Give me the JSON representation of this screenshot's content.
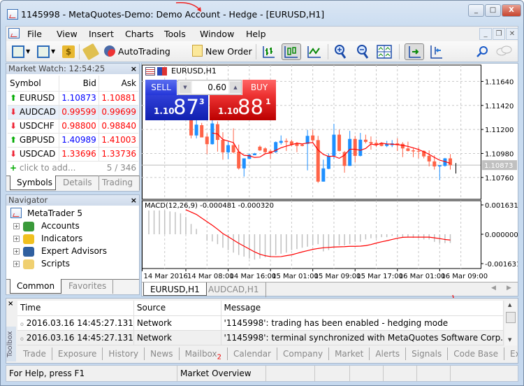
{
  "window": {
    "title": "1145998 - MetaQuotes-Demo: Demo Account - Hedge - [EURUSD,H1]",
    "minimize": "_",
    "maximize": "□",
    "close": "X"
  },
  "menu": [
    "File",
    "View",
    "Insert",
    "Charts",
    "Tools",
    "Window",
    "Help"
  ],
  "toolbar": {
    "autotrading": "AutoTrading",
    "new_order": "New Order",
    "icons": [
      "new-chart-icon",
      "profiles-icon",
      "market-watch-icon",
      "metaeditor-icon",
      "autotrading-icon",
      "new-order-icon",
      "bar-chart-icon",
      "candlestick-icon",
      "line-chart-icon",
      "zoom-in-icon",
      "zoom-out-icon",
      "tile-windows-icon",
      "autoscroll-icon",
      "chart-shift-icon",
      "search-icon",
      "chat-icon"
    ]
  },
  "market_watch": {
    "title": "Market Watch: 12:54:25",
    "columns": [
      "Symbol",
      "Bid",
      "Ask"
    ],
    "rows": [
      {
        "symbol": "EURUSD",
        "dir": "up",
        "bid": "1.10873",
        "ask": "1.10881",
        "bid_color": "blue"
      },
      {
        "symbol": "AUDCAD",
        "dir": "down",
        "bid": "0.99599",
        "ask": "0.99699",
        "bid_color": "red"
      },
      {
        "symbol": "USDCHF",
        "dir": "down",
        "bid": "0.98800",
        "ask": "0.98840",
        "bid_color": "red"
      },
      {
        "symbol": "GBPUSD",
        "dir": "up",
        "bid": "1.40989",
        "ask": "1.41003",
        "bid_color": "blue"
      },
      {
        "symbol": "USDCAD",
        "dir": "down",
        "bid": "1.33696",
        "ask": "1.33736",
        "bid_color": "red"
      }
    ],
    "add": "click to add...",
    "count": "5 / 346",
    "tabs": [
      "Symbols",
      "Details",
      "Trading"
    ]
  },
  "navigator": {
    "title": "Navigator",
    "root": "MetaTrader 5",
    "items": [
      "Accounts",
      "Indicators",
      "Expert Advisors",
      "Scripts"
    ],
    "tabs": [
      "Common",
      "Favorites"
    ]
  },
  "chart": {
    "symbol": "EURUSD,H1",
    "sell": "SELL",
    "buy": "BUY",
    "volume": "0.60",
    "sell_price": {
      "prefix": "1.10",
      "big": "87",
      "sup": "3"
    },
    "buy_price": {
      "prefix": "1.10",
      "big": "88",
      "sup": "1"
    },
    "price_ticks": [
      "1.11640",
      "1.11420",
      "1.11200",
      "1.10980",
      "1.10760"
    ],
    "current_price": "1.10873",
    "bull_color": "#1e90ff",
    "bear_color": "#ff6347",
    "ma_color": "#ff0000",
    "macd_label": "MACD(12,26,9) -0.000481 -0.000320",
    "macd_ticks": [
      "0.001631",
      "0.000000",
      "-0.001631"
    ],
    "time_labels": [
      "14 Mar 2016",
      "14 Mar 08:00",
      "14 Mar 16:00",
      "15 Mar 01:00",
      "15 Mar 09:00",
      "15 Mar 17:00",
      "16 Mar 01:00",
      "16 Mar 09:00"
    ],
    "tabs": [
      "EURUSD,H1",
      "AUDCAD,H1"
    ]
  },
  "chart_data": {
    "type": "candlestick",
    "ylim": [
      1.1056,
      1.1179
    ],
    "first_visible_bar": 8,
    "candles_ohlc": [
      [
        1.11301,
        1.1132,
        1.11118,
        1.11145
      ],
      [
        1.11145,
        1.11313,
        1.11118,
        1.11244
      ],
      [
        1.11239,
        1.1126,
        1.11127,
        1.11127
      ],
      [
        1.11134,
        1.11164,
        1.10974,
        1.11065
      ],
      [
        1.11065,
        1.11306,
        1.11061,
        1.11255
      ],
      [
        1.11248,
        1.11274,
        1.10997,
        1.11104
      ],
      [
        1.11104,
        1.11175,
        1.10923,
        1.1099
      ],
      [
        1.1099,
        1.1109,
        1.10928,
        1.11056
      ],
      [
        1.11056,
        1.1121,
        1.1098,
        1.1099
      ],
      [
        1.10997,
        1.11061,
        1.10832,
        1.10843
      ],
      [
        1.10843,
        1.10935,
        1.10768,
        1.10935
      ],
      [
        1.1093,
        1.1098,
        1.1093,
        1.10969
      ],
      [
        1.10964,
        1.10985,
        1.10964,
        1.1098
      ],
      [
        1.11042,
        1.11054,
        1.11003,
        1.11008
      ],
      [
        1.11026,
        1.11036,
        1.10976,
        1.10992
      ],
      [
        1.11003,
        1.11015,
        1.1093,
        1.1098
      ],
      [
        1.10992,
        1.1109,
        1.10985,
        1.11084
      ],
      [
        1.11077,
        1.11145,
        1.11061,
        1.11095
      ],
      [
        1.11095,
        1.11118,
        1.11003,
        1.11084
      ],
      [
        1.1109,
        1.11106,
        1.11049,
        1.11058
      ],
      [
        1.11072,
        1.11084,
        1.10992,
        1.11049
      ],
      [
        1.11061,
        1.11068,
        1.11045,
        1.11049
      ],
      [
        1.11068,
        1.11196,
        1.10825,
        1.11141
      ],
      [
        1.11145,
        1.11198,
        1.11084,
        1.111
      ],
      [
        1.11102,
        1.11141,
        1.1071,
        1.10722
      ],
      [
        1.10722,
        1.10923,
        1.10722,
        1.10843
      ],
      [
        1.10839,
        1.1098,
        1.10836,
        1.10958
      ],
      [
        1.10958,
        1.11251,
        1.1093,
        1.11152
      ],
      [
        1.11152,
        1.11198,
        1.10999,
        1.11003
      ],
      [
        1.10992,
        1.11003,
        1.10804,
        1.10866
      ],
      [
        1.10866,
        1.11187,
        1.10866,
        1.11113
      ],
      [
        1.11113,
        1.11141,
        1.109,
        1.10958
      ],
      [
        1.10958,
        1.11168,
        1.10953,
        1.11106
      ],
      [
        1.11106,
        1.11152,
        1.11072,
        1.11086
      ],
      [
        1.11084,
        1.11136,
        1.11015,
        1.11072
      ],
      [
        1.11077,
        1.11106,
        1.11038,
        1.11061
      ],
      [
        1.11077,
        1.11084,
        1.11045,
        1.11049
      ],
      [
        1.11049,
        1.11095,
        1.11038,
        1.11068
      ],
      [
        1.11056,
        1.11102,
        1.11038,
        1.11072
      ],
      [
        1.11072,
        1.11118,
        1.11003,
        1.11056
      ],
      [
        1.11068,
        1.11084,
        1.10946,
        1.11026
      ],
      [
        1.11026,
        1.11088,
        1.10999,
        1.11003
      ],
      [
        1.11008,
        1.11026,
        1.10946,
        1.10999
      ],
      [
        1.11003,
        1.11038,
        1.10935,
        1.10997
      ],
      [
        1.11003,
        1.11008,
        1.10935,
        1.10953
      ],
      [
        1.10958,
        1.11008,
        1.10861,
        1.10907
      ],
      [
        1.10907,
        1.10962,
        1.10832,
        1.10861
      ],
      [
        1.10861,
        1.10872,
        1.10736,
        1.10872
      ],
      [
        1.10866,
        1.10939,
        1.10859,
        1.10935
      ],
      [
        1.10935,
        1.10974,
        1.10832,
        1.10873
      ]
    ],
    "macd_ylim": [
      -0.001631,
      0.001631
    ],
    "macd_hist": [
      0.00132,
      0.00132,
      0.00132,
      0.00132,
      0.00127,
      0.00123,
      0.00116,
      0.00096,
      0.00057,
      0.0003,
      0.0,
      -0.00036,
      -0.0004,
      -0.00055,
      -0.00075,
      -0.00088,
      -0.00102,
      -0.00115,
      -0.00124,
      -0.00135,
      -0.00141,
      -0.00135,
      -0.00128,
      -0.00128,
      -0.00115,
      -0.00108,
      -0.00102,
      -0.00088,
      -0.00082,
      -0.00075,
      -0.00069,
      -0.00062,
      -0.00055,
      -0.00095,
      -0.00088,
      -0.00075,
      -0.00062,
      -0.00062,
      -0.00055,
      -0.00042,
      -0.00042,
      -0.00029,
      -0.00022,
      -0.00022,
      -0.00016,
      -0.00016,
      -9e-05,
      -0.00016,
      -0.00016,
      -0.00016,
      -0.0002,
      -0.00022,
      -0.00029,
      -0.00029,
      -0.00042,
      -0.00049,
      -0.00049,
      -0.000481
    ],
    "macd_signal": [
      null,
      null,
      null,
      null,
      null,
      null,
      null,
      0.00136,
      0.00123,
      0.0011,
      0.0009,
      0.0007,
      0.0005,
      0.00028,
      4e-05,
      -0.00013,
      -0.00032,
      -0.0005,
      -0.00066,
      -0.00082,
      -0.00098,
      -0.00111,
      -0.00119,
      -0.00124,
      -0.00125,
      -0.00124,
      -0.00119,
      -0.00114,
      -0.00106,
      -0.00098,
      -0.00091,
      -0.00084,
      -0.00079,
      -0.00075,
      -0.00073,
      -0.00071,
      -0.0007,
      -0.00069,
      -0.00067,
      -0.00067,
      -0.00066,
      -0.00063,
      -0.00057,
      -0.00049,
      -0.00042,
      -0.00036,
      -0.00029,
      -0.00022,
      -0.00017,
      -0.00016,
      -0.00016,
      -0.00016,
      -0.00016,
      -0.00016,
      -0.0002,
      -0.00024,
      -0.00029,
      -0.00032
    ]
  },
  "toolbox": {
    "label": "Toolbox",
    "columns": [
      "Time",
      "Source",
      "Message"
    ],
    "rows": [
      {
        "time": "2016.03.16 14:45:27.131",
        "source": "Network",
        "message": "'1145998': trading has been enabled - hedging mode"
      },
      {
        "time": "2016.03.16 14:45:27.131",
        "source": "Network",
        "message": "'1145998': terminal synchronized with MetaQuotes Software Corp."
      }
    ],
    "tabs": [
      "Trade",
      "Exposure",
      "History",
      "News",
      "Mailbox",
      "Calendar",
      "Company",
      "Market",
      "Alerts",
      "Signals",
      "Code Base",
      "Expert"
    ],
    "mailbox_badge": "2"
  },
  "status": {
    "help": "For Help, press F1",
    "profile": "Market Overview"
  }
}
